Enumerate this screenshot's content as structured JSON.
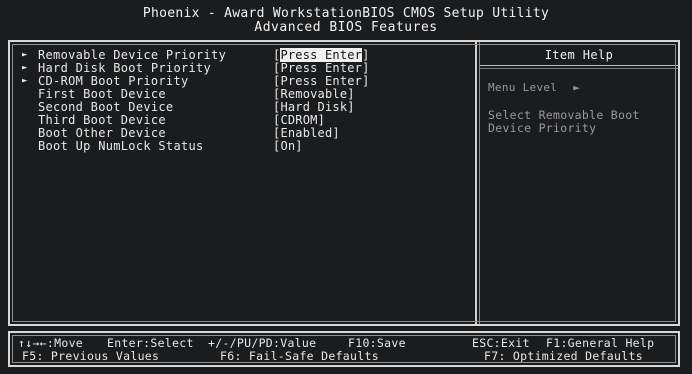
{
  "header": {
    "line1": "Phoenix - Award WorkstationBIOS CMOS Setup Utility",
    "line2": "Advanced BIOS Features"
  },
  "settings": [
    {
      "arrow": "►",
      "label": "Removable Device Priority",
      "value": "Press Enter",
      "open": "[",
      "close": "]",
      "selected": true
    },
    {
      "arrow": "►",
      "label": "Hard Disk Boot Priority",
      "value": "Press Enter",
      "open": "[",
      "close": "]",
      "selected": false
    },
    {
      "arrow": "►",
      "label": "CD-ROM Boot Priority",
      "value": "Press Enter",
      "open": "[",
      "close": "]",
      "selected": false
    },
    {
      "arrow": "",
      "label": "First Boot Device",
      "value": "Removable",
      "open": "[",
      "close": "]",
      "selected": false
    },
    {
      "arrow": "",
      "label": "Second Boot Device",
      "value": "Hard Disk",
      "open": "[",
      "close": "]",
      "selected": false
    },
    {
      "arrow": "",
      "label": "Third Boot Device",
      "value": "CDROM",
      "open": "[",
      "close": "]",
      "selected": false
    },
    {
      "arrow": "",
      "label": "Boot Other Device",
      "value": "Enabled",
      "open": "[",
      "close": "]",
      "selected": false
    },
    {
      "arrow": "",
      "label": "Boot Up NumLock Status",
      "value": "On",
      "open": "[",
      "close": "]",
      "selected": false
    }
  ],
  "help": {
    "title": "Item Help",
    "menu_level_label": "Menu Level",
    "menu_level_icon": "►",
    "text": "Select Removable Boot Device Priority"
  },
  "footer": {
    "move": "↑↓→←:Move",
    "select": "Enter:Select",
    "value": "+/-/PU/PD:Value",
    "save": "F10:Save",
    "exit": "ESC:Exit",
    "general_help": "F1:General Help",
    "previous_values": "F5: Previous Values",
    "failsafe": "F6: Fail-Safe Defaults",
    "optimized": "F7: Optimized Defaults"
  },
  "colors": {
    "background": "#1b1c1e",
    "text": "#e6e6e6",
    "help_text": "#9a9a9a",
    "highlight_bg": "#f0f0f0",
    "highlight_text": "#141414"
  }
}
